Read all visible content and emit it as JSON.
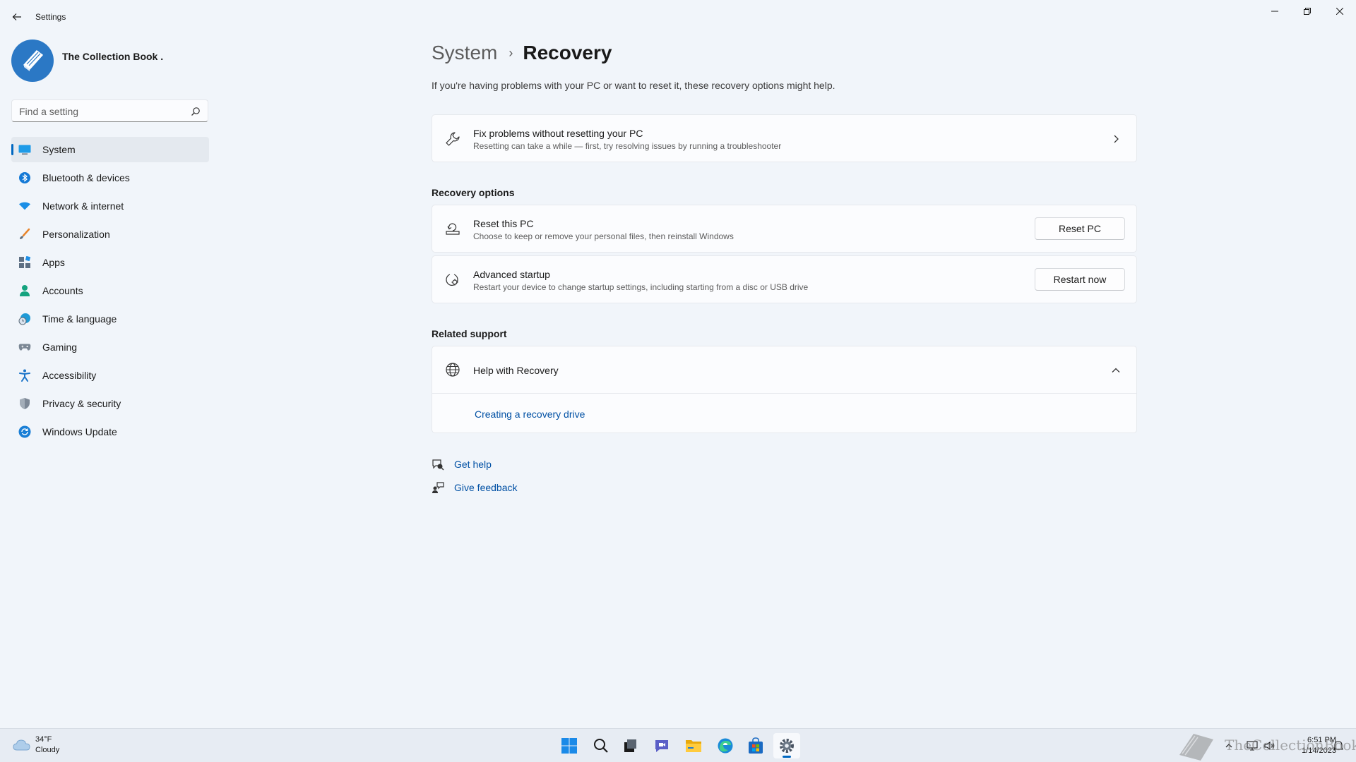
{
  "window": {
    "app_title": "Settings"
  },
  "profile": {
    "name": "The Collection Book ."
  },
  "search": {
    "placeholder": "Find a setting"
  },
  "sidebar": {
    "items": [
      {
        "label": "System",
        "icon": "system-icon",
        "active": true
      },
      {
        "label": "Bluetooth & devices",
        "icon": "bluetooth-icon"
      },
      {
        "label": "Network & internet",
        "icon": "wifi-icon"
      },
      {
        "label": "Personalization",
        "icon": "brush-icon"
      },
      {
        "label": "Apps",
        "icon": "apps-icon"
      },
      {
        "label": "Accounts",
        "icon": "person-icon"
      },
      {
        "label": "Time & language",
        "icon": "globe-clock-icon"
      },
      {
        "label": "Gaming",
        "icon": "gamepad-icon"
      },
      {
        "label": "Accessibility",
        "icon": "accessibility-icon"
      },
      {
        "label": "Privacy & security",
        "icon": "shield-icon"
      },
      {
        "label": "Windows Update",
        "icon": "update-icon"
      }
    ]
  },
  "main": {
    "breadcrumb": {
      "parent": "System",
      "separator": "›",
      "current": "Recovery"
    },
    "intro": "If you're having problems with your PC or want to reset it, these recovery options might help.",
    "fix_card": {
      "title": "Fix problems without resetting your PC",
      "description": "Resetting can take a while — first, try resolving issues by running a troubleshooter"
    },
    "recovery_options": {
      "heading": "Recovery options",
      "reset": {
        "title": "Reset this PC",
        "description": "Choose to keep or remove your personal files, then reinstall Windows",
        "button": "Reset PC"
      },
      "advanced": {
        "title": "Advanced startup",
        "description": "Restart your device to change startup settings, including starting from a disc or USB drive",
        "button": "Restart now"
      }
    },
    "related_support": {
      "heading": "Related support",
      "help_title": "Help with Recovery",
      "link": "Creating a recovery drive"
    },
    "footer_links": {
      "get_help": "Get help",
      "give_feedback": "Give feedback"
    }
  },
  "taskbar": {
    "weather": {
      "temp": "34°F",
      "desc": "Cloudy"
    },
    "apps": [
      "start-icon",
      "search-icon",
      "task-view-icon",
      "chat-icon",
      "file-explorer-icon",
      "edge-icon",
      "store-icon",
      "settings-icon"
    ],
    "clock": {
      "time": "6:51 PM",
      "date": "1/14/2023"
    },
    "watermark": "TheCollectionBook"
  },
  "colors": {
    "accent": "#0067c0",
    "link": "#0050a4",
    "background": "#f1f5fa",
    "card": "#fbfcfe"
  }
}
